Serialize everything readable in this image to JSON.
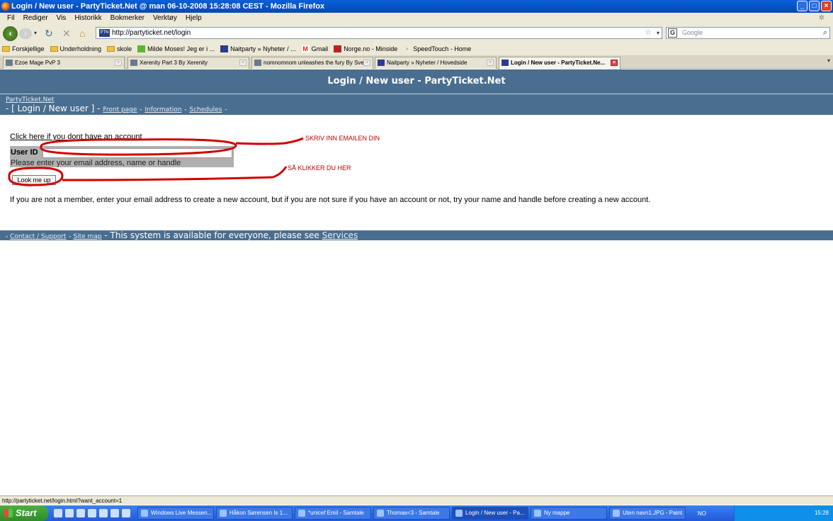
{
  "window": {
    "title": "Login / New user - PartyTicket.Net @ man 06-10-2008 15:28:08 CEST - Mozilla Firefox"
  },
  "menu": [
    "Fil",
    "Rediger",
    "Vis",
    "Historikk",
    "Bokmerker",
    "Verktøy",
    "Hjelp"
  ],
  "nav": {
    "url": "http://partyticket.net/login",
    "search_placeholder": "Google",
    "favicon": "PTN"
  },
  "bookmarks": [
    {
      "label": "Forskjellige",
      "icon": "folder"
    },
    {
      "label": "Underholdning",
      "icon": "folder"
    },
    {
      "label": "skole",
      "icon": "folder"
    },
    {
      "label": "Milde Moses! Jeg er i ...",
      "icon": "page"
    },
    {
      "label": "Naitparty » Nyheter / ...",
      "icon": "naitparty"
    },
    {
      "label": "Gmail",
      "icon": "gmail"
    },
    {
      "label": "Norge.no - Minside",
      "icon": "norge"
    },
    {
      "label": "SpeedTouch - Home",
      "icon": "page"
    }
  ],
  "tabs": [
    {
      "label": "Ezoe Mage PvP 3",
      "active": false
    },
    {
      "label": "Xerenity Part 3 By Xerenity",
      "active": false
    },
    {
      "label": "nomnomnom unleashes the fury By Sve...",
      "active": false
    },
    {
      "label": "Naitparty » Nyheter / Hovedside",
      "active": false
    },
    {
      "label": "Login / New user - PartyTicket.Ne...",
      "active": true
    }
  ],
  "page": {
    "header": "Login / New user - PartyTicket.Net",
    "site_link": "PartyTicket.Net",
    "crumb_current": "- [ Login / New user ] -",
    "crumb_links": [
      "Front page",
      "Information",
      "Schedules"
    ],
    "no_account_link": "Click here if you dont have an account",
    "userid_label": "User ID",
    "userid_value": "",
    "userid_hint": "Please enter your email address, name or handle",
    "lookup_button": "Look me up",
    "info_text": "If you are not a member, enter your email address to create a new account, but if you are not sure if you have an account or not, try your name and handle before creating a new account.",
    "footer_links": [
      "Contact / Support",
      "Site map"
    ],
    "footer_text": "- This system is available for everyone, please see",
    "footer_services": "Services"
  },
  "annotations": {
    "email": "SKRIV INN EMAILEN DIN",
    "click": "SÅ KLIKKER DU HER",
    "color": "#c00000"
  },
  "status": "http://partyticket.net/login.html?want_account=1",
  "taskbar": {
    "start": "Start",
    "buttons": [
      {
        "label": "Windows Live Messen...",
        "active": false
      },
      {
        "label": "Håkon Sørensen Is 1...",
        "active": false
      },
      {
        "label": "*unicef Emil - Samtale",
        "active": false
      },
      {
        "label": "Thomas<3 - Samtale",
        "active": false
      },
      {
        "label": "Login / New user - Pa...",
        "active": true
      },
      {
        "label": "Ny mappe",
        "active": false
      },
      {
        "label": "Uten navn1.JPG - Paint",
        "active": false
      }
    ],
    "lang": "NO",
    "clock": "15:28"
  }
}
